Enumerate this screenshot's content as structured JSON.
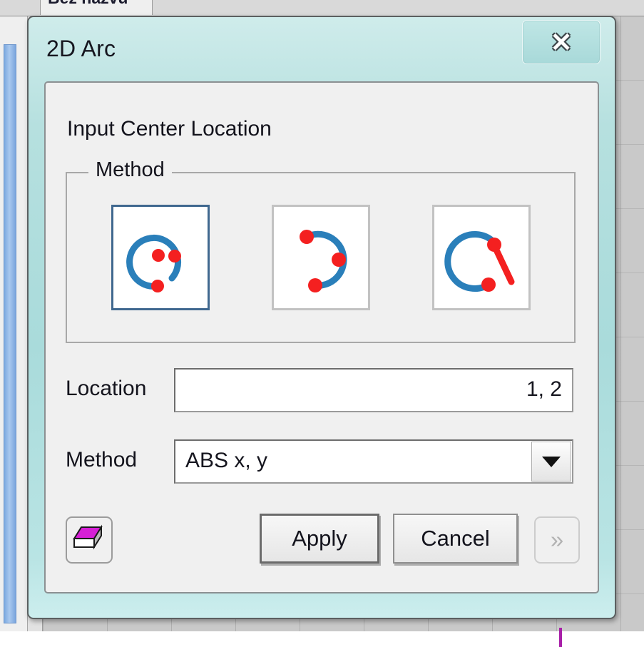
{
  "background": {
    "tab_label": "Bez nazvu",
    "grid_color": "#969696",
    "geometry_color": "#a81fa8",
    "scrollbar_color": "#7ca9e0"
  },
  "dialog": {
    "title": "2D Arc",
    "titlebar_color": "#a9dbdb",
    "close_icon": "close-x-icon",
    "section_title": "Input Center Location",
    "groupbox": {
      "label": "Method",
      "selected_index": 0,
      "arc_color": "#2a7fba",
      "point_color": "#f42020",
      "selected_border_color": "#40688f",
      "options": [
        {
          "name": "arc-center-start-end",
          "description": "Arc defined by center point, start point and end point",
          "selected": true
        },
        {
          "name": "arc-three-points",
          "description": "Arc defined by three points on the arc",
          "selected": false
        },
        {
          "name": "arc-center-radius-angle",
          "description": "Arc defined by center, radius line and end point",
          "selected": false
        }
      ]
    },
    "fields": [
      {
        "label": "Location",
        "type": "text",
        "value": "1, 2",
        "placeholder": ""
      },
      {
        "label": "Method",
        "type": "combobox",
        "value": "ABS x, y",
        "options": [
          "ABS x, y"
        ]
      }
    ],
    "buttons": {
      "eraser": {
        "label": "",
        "icon": "eraser-icon",
        "enabled": true
      },
      "apply": {
        "label": "Apply",
        "enabled": true,
        "default": true
      },
      "cancel": {
        "label": "Cancel",
        "enabled": true
      },
      "more": {
        "label": "»",
        "enabled": false
      }
    }
  }
}
